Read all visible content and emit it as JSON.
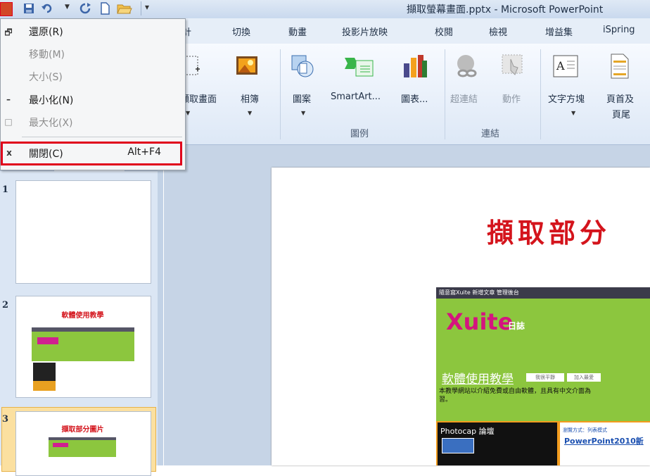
{
  "window": {
    "title": "擷取螢幕畫面.pptx - Microsoft PowerPoint"
  },
  "tabs": [
    "設計",
    "切換",
    "動畫",
    "投影片放映",
    "校閱",
    "檢視",
    "增益集",
    "iSpring"
  ],
  "ribbon": {
    "buttons": [
      {
        "label": "擷取畫面",
        "disabled": false
      },
      {
        "label": "相簿",
        "disabled": false
      },
      {
        "label": "圖案",
        "disabled": false
      },
      {
        "label": "SmartArt...",
        "disabled": false
      },
      {
        "label": "圖表...",
        "disabled": false
      },
      {
        "label": "超連結",
        "disabled": true
      },
      {
        "label": "動作",
        "disabled": true
      },
      {
        "label": "文字方塊",
        "disabled": false
      },
      {
        "label": "頁首及",
        "disabled": false
      },
      {
        "label": "頁尾",
        "disabled": false
      }
    ],
    "groups": [
      "圖例",
      "連結"
    ]
  },
  "system_menu": {
    "items": [
      {
        "label": "還原(R)",
        "icon": "restore-icon",
        "disabled": false
      },
      {
        "label": "移動(M)",
        "icon": "",
        "disabled": true
      },
      {
        "label": "大小(S)",
        "icon": "",
        "disabled": true
      },
      {
        "label": "最小化(N)",
        "icon": "minimize-icon",
        "disabled": false
      },
      {
        "label": "最大化(X)",
        "icon": "maximize-icon",
        "disabled": true
      },
      {
        "label": "關閉(C)",
        "icon": "close-icon",
        "shortcut": "Alt+F4",
        "disabled": false,
        "highlighted": true
      }
    ],
    "icon_glyphs": {
      "restore": "🗗",
      "minimize": "–",
      "maximize": "□",
      "close": "x"
    }
  },
  "slides": [
    {
      "number": "1",
      "title": ""
    },
    {
      "number": "2",
      "title": "軟體使用教學"
    },
    {
      "number": "3",
      "title": "擷取部分圖片"
    }
  ],
  "main_slide": {
    "title": "擷取部分",
    "screenshot": {
      "topbar": "隨意窩Xuite  新增文章  管理後台",
      "logo": "Xuite",
      "logo_suffix": "日誌",
      "blog_title": "軟體使用教學",
      "buttons": [
        "我很平靜",
        "加入最愛"
      ],
      "description": "本教學網站以介紹免費或自由軟體，且具有中文介面為",
      "description2": "習。",
      "sidebar_title": "Photocap 論壇",
      "post_link": "瀏覽方式：列表模式",
      "post_title": "PowerPoint2010新"
    }
  },
  "colors": {
    "menu_highlight_border": "#e0001b",
    "slide_title": "#d4141c",
    "xuite_green": "#8cc63e",
    "selected_thumb": "#fbe0a0"
  }
}
